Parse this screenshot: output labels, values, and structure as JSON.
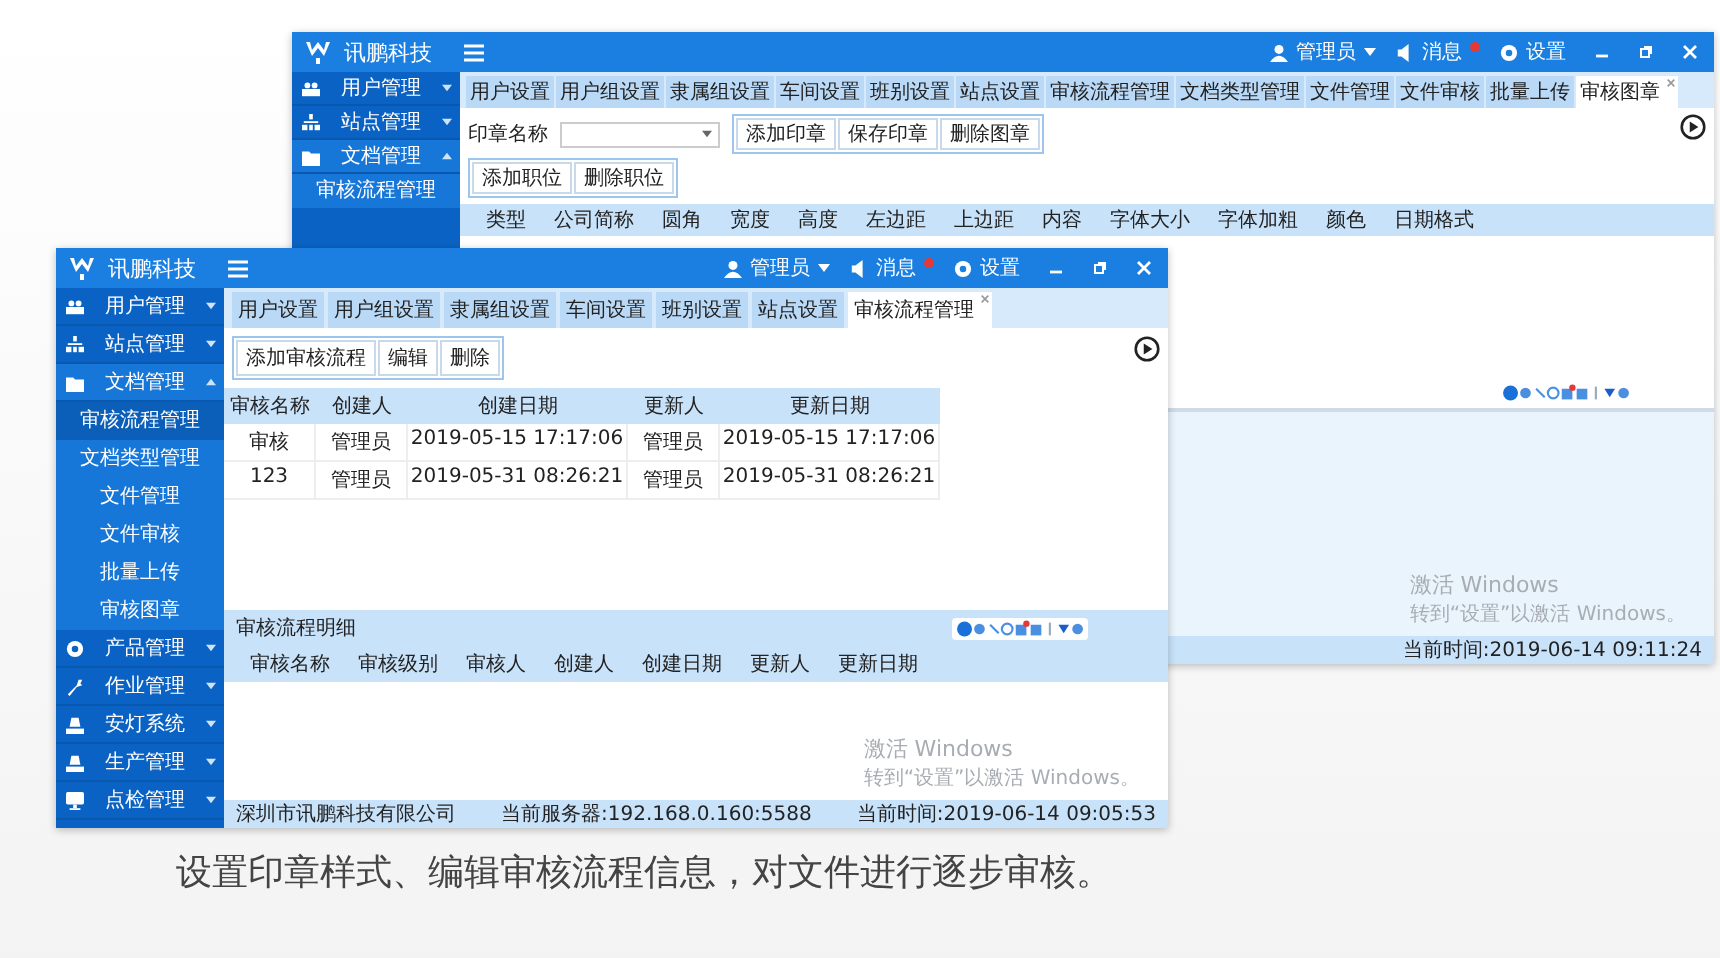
{
  "back_window": {
    "app_name": "讯鹏科技",
    "user": "管理员",
    "messages": "消息",
    "settings": "设置",
    "sidebar": [
      {
        "label": "用户管理",
        "expanded": false
      },
      {
        "label": "站点管理",
        "expanded": false
      },
      {
        "label": "文档管理",
        "expanded": true,
        "children": [
          {
            "label": "审核流程管理",
            "selected": false
          }
        ]
      }
    ],
    "tabs": [
      {
        "label": "用户设置",
        "selected": false
      },
      {
        "label": "用户组设置",
        "selected": false
      },
      {
        "label": "隶属组设置",
        "selected": false
      },
      {
        "label": "车间设置",
        "selected": false
      },
      {
        "label": "班别设置",
        "selected": false
      },
      {
        "label": "站点设置",
        "selected": false
      },
      {
        "label": "审核流程管理",
        "selected": false
      },
      {
        "label": "文档类型管理",
        "selected": false
      },
      {
        "label": "文件管理",
        "selected": false
      },
      {
        "label": "文件审核",
        "selected": false
      },
      {
        "label": "批量上传",
        "selected": false
      },
      {
        "label": "审核图章",
        "selected": true
      }
    ],
    "seal_field": {
      "label": "印章名称"
    },
    "buttons": [
      "添加印章",
      "保存印章",
      "删除图章"
    ],
    "buttons_2": [
      "添加职位",
      "删除职位"
    ],
    "columns": [
      "类型",
      "公司简称",
      "圆角",
      "宽度",
      "高度",
      "左边距",
      "上边距",
      "内容",
      "字体大小",
      "字体加粗",
      "颜色",
      "日期格式"
    ],
    "activation": {
      "title": "激活 Windows",
      "hint": "转到“设置”以激活 Windows。"
    },
    "status": {
      "time": "当前时间:2019-06-14 09:11:24"
    }
  },
  "front_window": {
    "app_name": "讯鹏科技",
    "user": "管理员",
    "messages": "消息",
    "settings": "设置",
    "sidebar": [
      {
        "label": "用户管理",
        "expanded": false
      },
      {
        "label": "站点管理",
        "expanded": false
      },
      {
        "label": "文档管理",
        "expanded": true,
        "children": [
          {
            "label": "审核流程管理",
            "selected": true
          },
          {
            "label": "文档类型管理",
            "selected": false
          },
          {
            "label": "文件管理",
            "selected": false
          },
          {
            "label": "文件审核",
            "selected": false
          },
          {
            "label": "批量上传",
            "selected": false
          },
          {
            "label": "审核图章",
            "selected": false
          }
        ]
      },
      {
        "label": "产品管理",
        "expanded": false
      },
      {
        "label": "作业管理",
        "expanded": false
      },
      {
        "label": "安灯系统",
        "expanded": false
      },
      {
        "label": "生产管理",
        "expanded": false
      },
      {
        "label": "点检管理",
        "expanded": false
      }
    ],
    "tabs": [
      {
        "label": "用户设置",
        "selected": false
      },
      {
        "label": "用户组设置",
        "selected": false
      },
      {
        "label": "隶属组设置",
        "selected": false
      },
      {
        "label": "车间设置",
        "selected": false
      },
      {
        "label": "班别设置",
        "selected": false
      },
      {
        "label": "站点设置",
        "selected": false
      },
      {
        "label": "审核流程管理",
        "selected": true
      }
    ],
    "buttons": [
      "添加审核流程",
      "编辑",
      "删除"
    ],
    "table": {
      "columns": [
        "审核名称",
        "创建人",
        "创建日期",
        "更新人",
        "更新日期"
      ],
      "rows": [
        [
          "审核",
          "管理员",
          "2019-05-15 17:17:06",
          "管理员",
          "2019-05-15 17:17:06"
        ],
        [
          "123",
          "管理员",
          "2019-05-31 08:26:21",
          "管理员",
          "2019-05-31 08:26:21"
        ]
      ]
    },
    "detail": {
      "title": "审核流程明细",
      "columns": [
        "审核名称",
        "审核级别",
        "审核人",
        "创建人",
        "创建日期",
        "更新人",
        "更新日期"
      ]
    },
    "activation": {
      "title": "激活 Windows",
      "hint": "转到“设置”以激活 Windows。"
    },
    "status": {
      "company": "深圳市讯鹏科技有限公司",
      "server": "当前服务器:192.168.0.160:5588",
      "time": "当前时间:2019-06-14 09:05:53"
    }
  },
  "caption": "设置印章样式、编辑审核流程信息，对文件进行逐步审核。"
}
